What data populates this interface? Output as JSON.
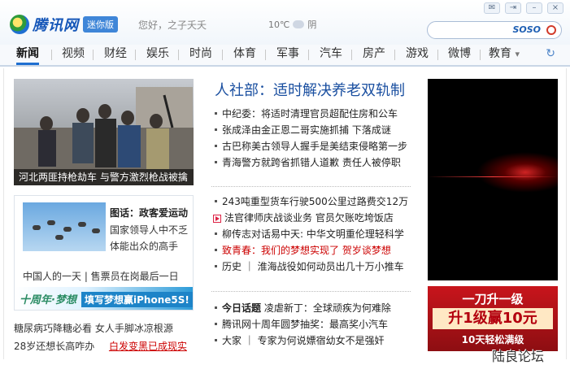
{
  "header": {
    "logo_text": "腾讯网",
    "badge": "迷你版",
    "greeting": "您好，之子夭夭",
    "weather_temp": "10℃",
    "weather_desc": "阴",
    "search_brand": "SOSO"
  },
  "nav": {
    "items": [
      "新闻",
      "视频",
      "财经",
      "娱乐",
      "时尚",
      "体育",
      "军事",
      "汽车",
      "房产",
      "游戏",
      "微博",
      "教育"
    ],
    "active": "新闻",
    "more_arrow": "▾"
  },
  "left": {
    "photo_caption": "河北两匪持枪劫车 与警方激烈枪战被擒",
    "feature_title": "图话：政客爱运动",
    "feature_desc": "国家领导人中不乏体能出众的高手",
    "feature_links": "中国人的一天 | 售票员在岗最后一日",
    "banner_text1": "十周年·梦想",
    "banner_text2": "填写梦想赢iPhone5S!",
    "bottom_row1": "糖尿病巧降糖必看   女人手脚冰凉根源",
    "bottom_row2_a": "28岁还想长高咋办",
    "bottom_row2_b": "白发变黑已成现实"
  },
  "center": {
    "headline": "人社部：适时解决养老双轨制",
    "group1": [
      "中纪委：将适时清理官员超配住房和公车",
      "张成泽由金正恩二哥实施抓捕 下落成谜",
      "古巴称美古领导人握手是美结束侵略第一步",
      "青海警方就跨省抓错人道歉 责任人被停职"
    ],
    "group2": [
      "243吨重型货车行驶500公里过路费交12万",
      "法官律师庆战谈业务 官员欠账吃垮饭店",
      "柳传志对话易中天: 中华文明重伦理轻科学",
      "致青春：我们的梦想实现了 贺岁谈梦想",
      "历史 ｜ 淮海战役如何动员出几十万小推车"
    ],
    "group3": [
      {
        "tag": "今日话题",
        "text": "凌虐新丁：全球顽疾为何难除"
      },
      {
        "tag": "",
        "text": "腾讯网十周年圆梦抽奖：最高奖小汽车"
      },
      {
        "tag": "",
        "text": "大家 ｜ 专家为何说嫖宿幼女不是强奸"
      }
    ]
  },
  "ads": {
    "ad2_line1": "一刀升一级",
    "ad2_line2": "升1级赢10元",
    "ad2_line3": "10天轻松满级"
  },
  "watermark": "陆良论坛"
}
